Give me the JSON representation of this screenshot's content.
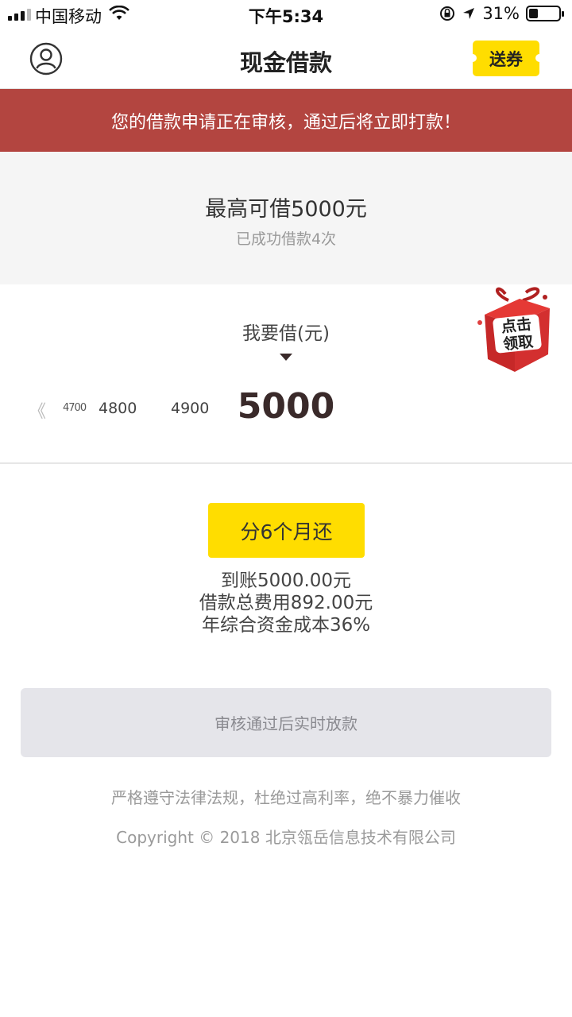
{
  "status_bar": {
    "carrier": "中国移动",
    "time": "下午5:34",
    "battery_percent": "31%",
    "battery_level": 0.31,
    "icons": [
      "signal-icon",
      "wifi-icon",
      "rotation-lock-icon",
      "location-icon",
      "battery-icon"
    ]
  },
  "nav": {
    "title": "现金借款",
    "coupon_label": "送券",
    "icons": [
      "user-profile-icon"
    ]
  },
  "banner": {
    "text": "您的借款申请正在审核，通过后将立即打款！",
    "color": "#b34540"
  },
  "limit": {
    "max_text": "最高可借5000元",
    "count_text": "已成功借款4次"
  },
  "borrow": {
    "label": "我要借(元)",
    "gift_text": "点击领取",
    "ruler": {
      "chevron": "《",
      "values": [
        "4700",
        "4800",
        "4900"
      ],
      "selected": "5000"
    }
  },
  "term": {
    "button_label": "分6个月还",
    "details": [
      "到账5000.00元",
      "借款总费用892.00元",
      "年综合资金成本36%"
    ]
  },
  "submit": {
    "label": "审核通过后实时放款"
  },
  "footer": {
    "notice": "严格遵守法律法规，杜绝过高利率，绝不暴力催收",
    "copyright": "Copyright © 2018 北京瓴岳信息技术有限公司"
  },
  "colors": {
    "accent_yellow": "#ffdd00",
    "banner_red": "#b34540",
    "text_dark": "#3a2a2a"
  }
}
